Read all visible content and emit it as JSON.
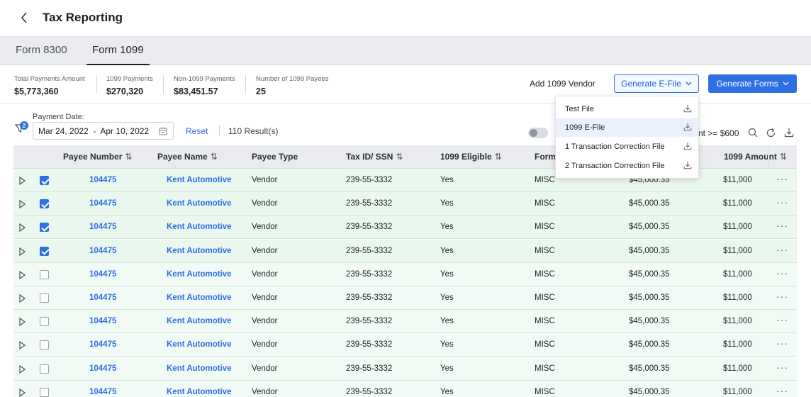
{
  "header": {
    "title": "Tax Reporting"
  },
  "tabs": [
    {
      "label": "Form 8300"
    },
    {
      "label": "Form 1099"
    }
  ],
  "summary": {
    "stats": [
      {
        "label": "Total Payments Amount",
        "value": "$5,773,360"
      },
      {
        "label": "1099 Payments",
        "value": "$270,320"
      },
      {
        "label": "Non-1099 Payments",
        "value": "$83,451.57"
      },
      {
        "label": "Number of 1099 Payees",
        "value": "25"
      }
    ],
    "add_vendor": "Add 1099 Vendor",
    "generate_efile": "Generate E-File",
    "generate_forms": "Generate Forms"
  },
  "filters": {
    "badge": "2",
    "date_label": "Payment Date:",
    "date_value": "Mar 24, 2022  -  Apr 10, 2022",
    "reset": "Reset",
    "results": "110 Result(s)",
    "toggle_text": "nt >= $600"
  },
  "dropdown": {
    "items": [
      {
        "label": "Test File"
      },
      {
        "label": "1099 E-File"
      },
      {
        "label": "1 Transaction Correction File"
      },
      {
        "label": "2 Transaction Correction File"
      }
    ]
  },
  "table": {
    "headers": {
      "payee_number": "Payee Number",
      "payee_name": "Payee Name",
      "payee_type": "Payee Type",
      "tax_id": "Tax ID/ SSN",
      "eligible": "1099 Eligible",
      "form": "Form",
      "amount": "1099 Amount"
    },
    "rows": [
      {
        "selected": true,
        "number": "104475",
        "name": "Kent Automotive",
        "type": "Vendor",
        "tax_id": "239-55-3332",
        "eligible": "Yes",
        "form": "MISC",
        "total": "$45,000.35",
        "amount": "$11,000"
      },
      {
        "selected": true,
        "number": "104475",
        "name": "Kent Automotive",
        "type": "Vendor",
        "tax_id": "239-55-3332",
        "eligible": "Yes",
        "form": "MISC",
        "total": "$45,000.35",
        "amount": "$11,000"
      },
      {
        "selected": true,
        "number": "104475",
        "name": "Kent Automotive",
        "type": "Vendor",
        "tax_id": "239-55-3332",
        "eligible": "Yes",
        "form": "MISC",
        "total": "$45,000.35",
        "amount": "$11,000"
      },
      {
        "selected": true,
        "number": "104475",
        "name": "Kent Automotive",
        "type": "Vendor",
        "tax_id": "239-55-3332",
        "eligible": "Yes",
        "form": "MISC",
        "total": "$45,000.35",
        "amount": "$11,000"
      },
      {
        "selected": false,
        "number": "104475",
        "name": "Kent Automotive",
        "type": "Vendor",
        "tax_id": "239-55-3332",
        "eligible": "Yes",
        "form": "MISC",
        "total": "$45,000.35",
        "amount": "$11,000"
      },
      {
        "selected": false,
        "number": "104475",
        "name": "Kent Automotive",
        "type": "Vendor",
        "tax_id": "239-55-3332",
        "eligible": "Yes",
        "form": "MISC",
        "total": "$45,000.35",
        "amount": "$11,000"
      },
      {
        "selected": false,
        "number": "104475",
        "name": "Kent Automotive",
        "type": "Vendor",
        "tax_id": "239-55-3332",
        "eligible": "Yes",
        "form": "MISC",
        "total": "$45,000.35",
        "amount": "$11,000"
      },
      {
        "selected": false,
        "number": "104475",
        "name": "Kent Automotive",
        "type": "Vendor",
        "tax_id": "239-55-3332",
        "eligible": "Yes",
        "form": "MISC",
        "total": "$45,000.35",
        "amount": "$11,000"
      },
      {
        "selected": false,
        "number": "104475",
        "name": "Kent Automotive",
        "type": "Vendor",
        "tax_id": "239-55-3332",
        "eligible": "Yes",
        "form": "MISC",
        "total": "$45,000.35",
        "amount": "$11,000"
      },
      {
        "selected": false,
        "number": "104475",
        "name": "Kent Automotive",
        "type": "Vendor",
        "tax_id": "239-55-3332",
        "eligible": "Yes",
        "form": "MISC",
        "total": "$45,000.35",
        "amount": "$11,000"
      }
    ]
  },
  "colors": {
    "accent": "#2f6fe4",
    "row_selected": "#eaf7ef",
    "row_border": "#cfe5d8"
  }
}
